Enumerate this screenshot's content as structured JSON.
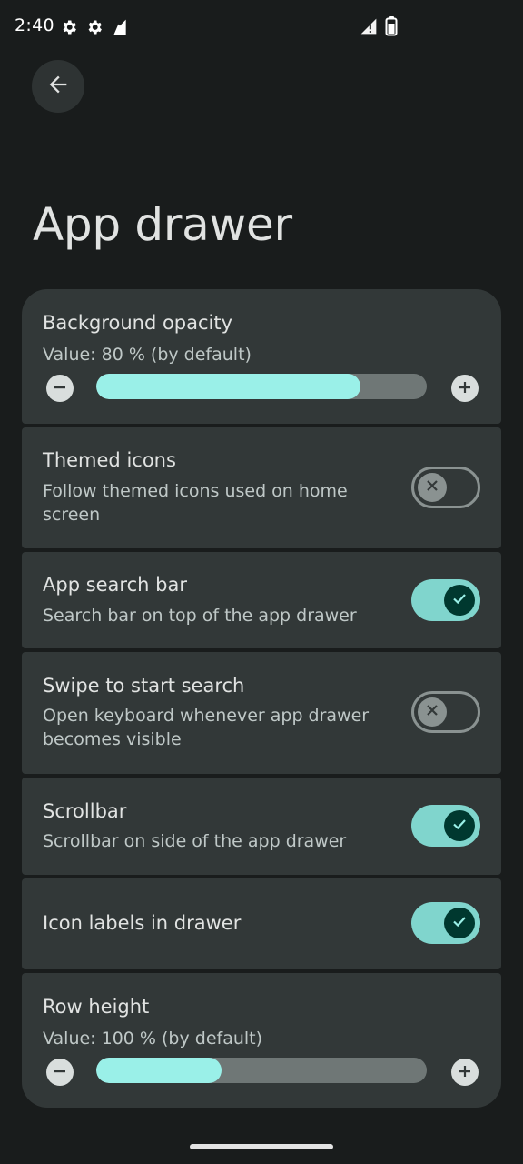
{
  "status_bar": {
    "time": "2:40",
    "icons": [
      "settings-gear-icon",
      "settings-gear-icon",
      "signal-partial-icon",
      "signal-no-data-icon",
      "battery-icon"
    ]
  },
  "header": {
    "title": "App drawer"
  },
  "settings": {
    "background_opacity": {
      "title": "Background opacity",
      "value_text": "Value: 80 % (by default)",
      "value_percent": 80
    },
    "themed_icons": {
      "title": "Themed icons",
      "subtitle": "Follow themed icons used on home screen",
      "enabled": false
    },
    "app_search_bar": {
      "title": "App search bar",
      "subtitle": "Search bar on top of the app drawer",
      "enabled": true
    },
    "swipe_to_start_search": {
      "title": "Swipe to start search",
      "subtitle": "Open keyboard whenever app drawer becomes visible",
      "enabled": false
    },
    "scrollbar": {
      "title": "Scrollbar",
      "subtitle": "Scrollbar on side of the app drawer",
      "enabled": true
    },
    "icon_labels_in_drawer": {
      "title": "Icon labels in drawer",
      "enabled": true
    },
    "row_height": {
      "title": "Row height",
      "value_text": "Value: 100 % (by default)",
      "slider_fraction": 0.38
    }
  },
  "colors": {
    "background": "#191c1c",
    "card": "#323838",
    "accent": "#80d5cd",
    "slider_fill": "#9af0e8"
  }
}
